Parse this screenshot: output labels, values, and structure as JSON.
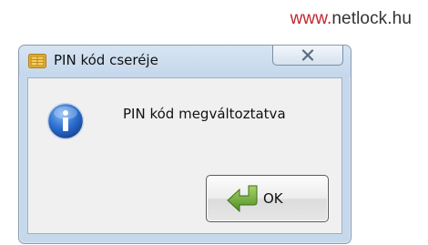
{
  "brand": {
    "prefix": "www.",
    "name": "netlock",
    "suffix": ".hu"
  },
  "dialog": {
    "title": "PIN kód cseréje",
    "title_icon": "smartcard-chip-icon",
    "close_icon": "close-icon",
    "message": "PIN kód megváltoztatva",
    "message_icon": "info-icon",
    "ok_label": "OK",
    "ok_icon": "green-arrow-icon"
  },
  "colors": {
    "brand_accent": "#c1272d",
    "frame": "#c6d8ec",
    "client": "#f0f0f0"
  }
}
